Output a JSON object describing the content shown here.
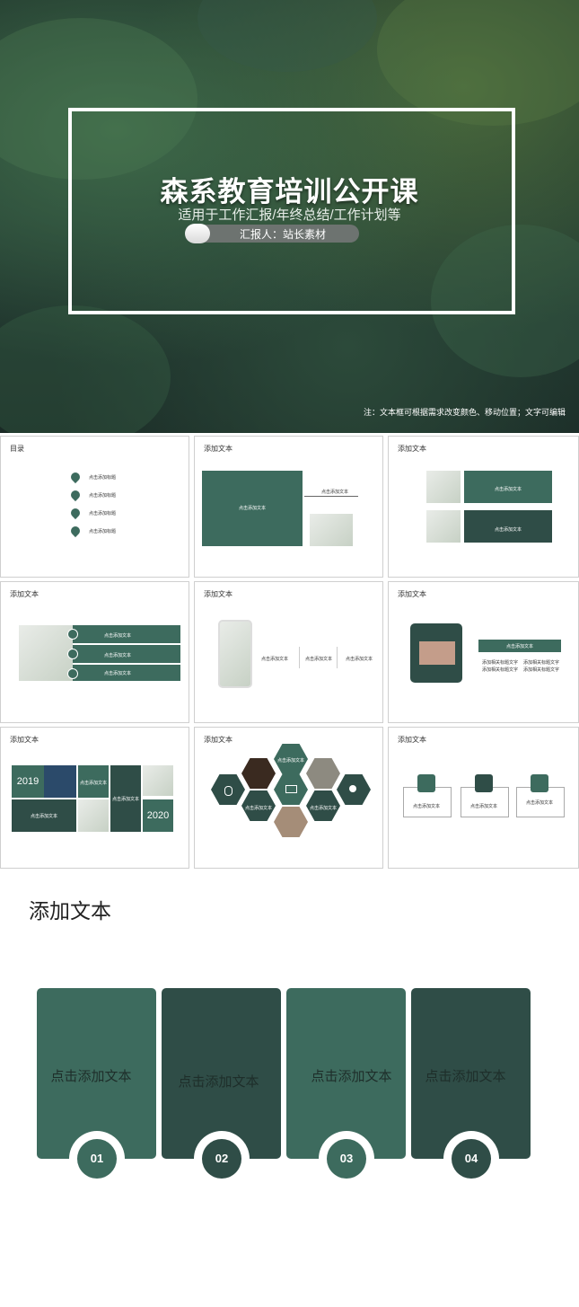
{
  "hero": {
    "title": "森系教育培训公开课",
    "subtitle": "适用于工作汇报/年终总结/工作计划等",
    "reporter": "汇报人：站长素材",
    "note": "注：文本框可根据需求改变颜色、移动位置；文字可编辑"
  },
  "slides": {
    "s1": {
      "title": "目录",
      "items": [
        "点击添加标题",
        "点击添加标题",
        "点击添加标题",
        "点击添加标题"
      ]
    },
    "s2": {
      "title": "添加文本",
      "box": "点击添加文本",
      "side": "点击添加文本"
    },
    "s3": {
      "title": "添加文本",
      "a": "点击添加文本",
      "b": "点击添加文本"
    },
    "s4": {
      "title": "添加文本",
      "rows": [
        "点击添加文本",
        "点击添加文本",
        "点击添加文本"
      ]
    },
    "s5": {
      "title": "添加文本",
      "cols": [
        "点击添加文本",
        "点击添加文本",
        "点击添加文本"
      ]
    },
    "s6": {
      "title": "添加文本",
      "header": "点击添加文本",
      "bullets": [
        "添加相关标题文字",
        "添加相关标题文字",
        "添加相关标题文字",
        "添加相关标题文字"
      ]
    },
    "s7": {
      "title": "添加文本",
      "year1": "2019",
      "year2": "2020",
      "t1": "点击添加文本",
      "t2": "点击添加文本",
      "t3": "点击添加文本"
    },
    "s8": {
      "title": "添加文本",
      "h1": "点击添加文本",
      "h2": "点击添加文本",
      "h3": "点击添加文本"
    },
    "s9": {
      "title": "添加文本",
      "boxes": [
        "点击添加文本",
        "点击添加文本",
        "点击添加文本"
      ]
    }
  },
  "bottom": {
    "title": "添加文本",
    "cards": [
      {
        "text": "点击添加文本",
        "num": "01"
      },
      {
        "text": "点击添加文本",
        "num": "02"
      },
      {
        "text": "点击添加文本",
        "num": "03"
      },
      {
        "text": "点击添加文本",
        "num": "04"
      }
    ]
  },
  "colors": {
    "green": "#3d6b5e",
    "dark_green": "#2f4d47"
  }
}
